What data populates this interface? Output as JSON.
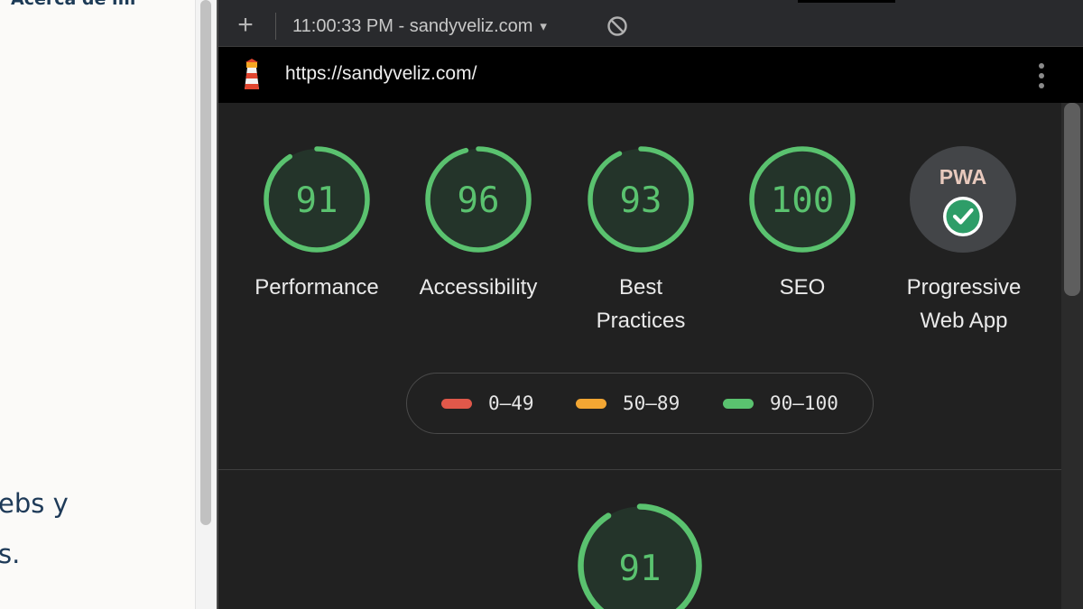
{
  "site": {
    "heading": "Acerca de mí",
    "text_lines": [
      "ebs y",
      "s."
    ]
  },
  "devtools": {
    "toolbar": {
      "add_icon": "plus-icon",
      "report_selector": "11:00:33 PM - sandyveliz.com",
      "caret": "▾",
      "clear_icon": "block-icon"
    },
    "urlbar": {
      "icon": "lighthouse-icon",
      "url": "https://sandyveliz.com/",
      "menu_icon": "kebab-menu-icon"
    },
    "categories": [
      {
        "score": "91",
        "value": 91,
        "label_lines": [
          "Performance"
        ]
      },
      {
        "score": "96",
        "value": 96,
        "label_lines": [
          "Accessibility"
        ]
      },
      {
        "score": "93",
        "value": 93,
        "label_lines": [
          "Best",
          "Practices"
        ]
      },
      {
        "score": "100",
        "value": 100,
        "label_lines": [
          "SEO"
        ]
      }
    ],
    "pwa": {
      "badge_text": "PWA",
      "label_lines": [
        "Progressive",
        "Web App"
      ],
      "status": "check"
    },
    "legend": [
      {
        "range": "0–49",
        "color": "#e0584a"
      },
      {
        "range": "50–89",
        "color": "#f2a633"
      },
      {
        "range": "90–100",
        "color": "#5ac26f"
      }
    ],
    "detail_gauge": {
      "score": "91",
      "value": 91
    },
    "colors": {
      "pass": "#5ac26f",
      "pass_fill": "#24342a",
      "panel_bg": "#212121"
    }
  }
}
